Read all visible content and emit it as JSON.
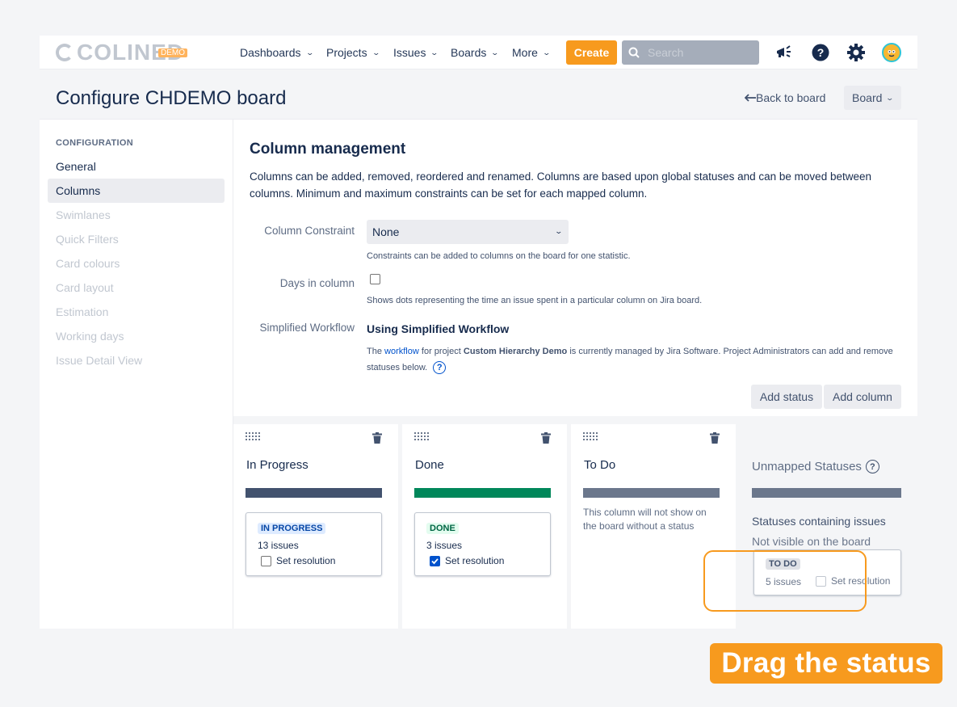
{
  "nav": {
    "logo_text": "COLINED",
    "logo_badge": "DEMO",
    "items": [
      "Dashboards",
      "Projects",
      "Issues",
      "Boards",
      "More"
    ],
    "create_label": "Create",
    "search_placeholder": "Search",
    "accent_color": "#f79a1e"
  },
  "header": {
    "title": "Configure CHDEMO board",
    "back_label": "Back to board",
    "board_label": "Board"
  },
  "sidebar": {
    "heading": "CONFIGURATION",
    "items": [
      {
        "label": "General",
        "state": "normal"
      },
      {
        "label": "Columns",
        "state": "active"
      },
      {
        "label": "Swimlanes",
        "state": "disabled"
      },
      {
        "label": "Quick Filters",
        "state": "disabled"
      },
      {
        "label": "Card colours",
        "state": "disabled"
      },
      {
        "label": "Card layout",
        "state": "disabled"
      },
      {
        "label": "Estimation",
        "state": "disabled"
      },
      {
        "label": "Working days",
        "state": "disabled"
      },
      {
        "label": "Issue Detail View",
        "state": "disabled"
      }
    ]
  },
  "main": {
    "title": "Column management",
    "description": "Columns can be added, removed, reordered and renamed. Columns are based upon global statuses and can be moved between columns. Minimum and maximum constraints can be set for each mapped column.",
    "constraint_label": "Column Constraint",
    "constraint_value": "None",
    "constraint_help": "Constraints can be added to columns on the board for one statistic.",
    "days_label": "Days in column",
    "days_checked": false,
    "days_help": "Shows dots representing the time an issue spent in a particular column on Jira board.",
    "workflow_label": "Simplified Workflow",
    "workflow_value": "Using Simplified Workflow",
    "workflow_help_pre": "The",
    "workflow_help_link": "workflow",
    "workflow_help_mid": "for project",
    "workflow_help_project": "Custom Hierarchy Demo",
    "workflow_help_post": "is currently managed by Jira Software. Project Administrators can add and remove statuses below.",
    "add_status_label": "Add status",
    "add_column_label": "Add column"
  },
  "columns": [
    {
      "title": "In Progress",
      "bar_color": "#42526e",
      "status": {
        "name": "IN PROGRESS",
        "issues": "13 issues",
        "resolution_label": "Set resolution",
        "resolution_checked": false,
        "lozenge_bg": "#deebff",
        "lozenge_fg": "#0747a6"
      }
    },
    {
      "title": "Done",
      "bar_color": "#00875a",
      "status": {
        "name": "DONE",
        "issues": "3 issues",
        "resolution_label": "Set resolution",
        "resolution_checked": true,
        "lozenge_bg": "#e3fcef",
        "lozenge_fg": "#006644"
      }
    },
    {
      "title": "To Do",
      "bar_color": "#6b778c",
      "note": "This column will not show on the board without a status"
    }
  ],
  "unmapped": {
    "title": "Unmapped Statuses",
    "sub1": "Statuses containing issues",
    "sub2": "Not visible on the board",
    "status": {
      "name": "TO DO",
      "issues": "5 issues",
      "resolution_label": "Set resolution",
      "resolution_checked": false
    }
  },
  "banner": {
    "text": "Drag the status"
  }
}
